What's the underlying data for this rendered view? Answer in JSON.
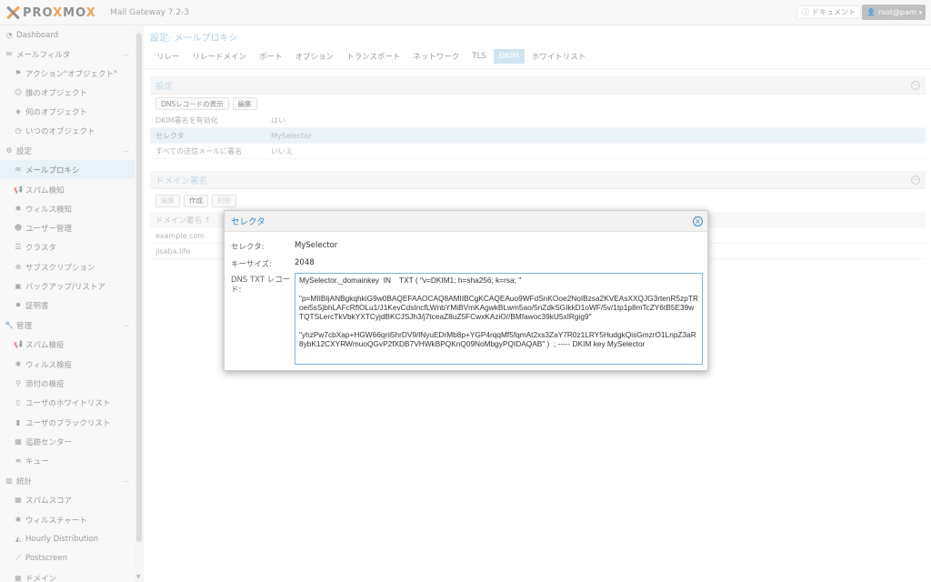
{
  "app": {
    "brand_pre": "PRO",
    "brand_x": "X",
    "brand_mo": "MO",
    "brand_x2": "X",
    "version": "Mail Gateway 7.2-3"
  },
  "topbar": {
    "docs_label": "ドキュメント",
    "user_label": "root@pam"
  },
  "sidebar": {
    "items": [
      {
        "label": "Dashboard",
        "icon": "dashboard-icon"
      },
      {
        "label": "メールフィルタ",
        "icon": "envelope-icon"
      },
      {
        "label": "アクション\"オブジェクト\"",
        "icon": "flag-icon"
      },
      {
        "label": "誰のオブジェクト",
        "icon": "user-icon"
      },
      {
        "label": "何のオブジェクト",
        "icon": "cube-icon"
      },
      {
        "label": "いつのオブジェクト",
        "icon": "clock-icon"
      },
      {
        "label": "設定",
        "icon": "gears-icon"
      },
      {
        "label": "メールプロキシ",
        "icon": "envelope-o-icon"
      },
      {
        "label": "スパム検知",
        "icon": "bullhorn-icon"
      },
      {
        "label": "ウィルス検知",
        "icon": "bug-icon"
      },
      {
        "label": "ユーザー管理",
        "icon": "users-icon"
      },
      {
        "label": "クラスタ",
        "icon": "server-icon"
      },
      {
        "label": "サブスクリプション",
        "icon": "support-icon"
      },
      {
        "label": "バックアップ/リストア",
        "icon": "floppy-icon"
      },
      {
        "label": "証明書",
        "icon": "certificate-icon"
      },
      {
        "label": "管理",
        "icon": "wrench-icon"
      },
      {
        "label": "スパム検疫",
        "icon": "bullhorn-icon"
      },
      {
        "label": "ウィルス検疫",
        "icon": "bug-icon"
      },
      {
        "label": "添付の検疫",
        "icon": "paperclip-icon"
      },
      {
        "label": "ユーザのホワイトリスト",
        "icon": "file-o-icon"
      },
      {
        "label": "ユーザのブラックリスト",
        "icon": "file-icon"
      },
      {
        "label": "追跡センター",
        "icon": "map-icon"
      },
      {
        "label": "キュー",
        "icon": "bars-icon"
      },
      {
        "label": "統計",
        "icon": "bar-chart-icon"
      },
      {
        "label": "スパムスコア",
        "icon": "table-icon"
      },
      {
        "label": "ウィルスチャート",
        "icon": "bug-icon"
      },
      {
        "label": "Hourly Distribution",
        "icon": "area-chart-icon"
      },
      {
        "label": "Postscreen",
        "icon": "line-chart-icon"
      },
      {
        "label": "ドメイン",
        "icon": "table-icon"
      }
    ]
  },
  "main": {
    "title": "設定: メールプロキシ",
    "tabs": [
      "リレー",
      "リレードメイン",
      "ポート",
      "オプション",
      "トランスポート",
      "ネットワーク",
      "TLS",
      "DKIM",
      "ホワイトリスト"
    ],
    "active_tab": "DKIM",
    "settings": {
      "header": "設定",
      "btn_dns": "DNSレコードの表示",
      "btn_edit": "編集",
      "rows": [
        {
          "key": "DKIM署名を有効化",
          "value": "はい"
        },
        {
          "key": "セレクタ",
          "value": "MySelector"
        },
        {
          "key": "すべての送信メールに署名",
          "value": "いいえ"
        }
      ]
    },
    "domains": {
      "header": "ドメイン署名",
      "btn_edit": "編集",
      "btn_create": "作成",
      "btn_delete": "削除",
      "col_header": "ドメイン署名 ↑",
      "rows": [
        "example.com",
        "jisaba.life"
      ]
    }
  },
  "dialog": {
    "title": "セレクタ",
    "selector_label": "セレクタ:",
    "selector_value": "MySelector",
    "keysize_label": "キーサイズ:",
    "keysize_value": "2048",
    "dns_label": "DNS TXT レコード:",
    "dns_value": "MySelector._domainkey  IN    TXT ( \"v=DKIM1; h=sha256; k=rsa; \"\n\n\"p=MIIBIjANBgkqhkiG9w0BAQEFAAOCAQ8AMIIBCgKCAQEAuo9WFdSnKOoe2NoIBzsa2KVEAsXXQJG3rtenR5zpTRoei5sSjbhLAFcRflOLu1/J1KevCdsIncfLWnbYMiBVmKAgwkBLwm5ao/5nZdkSGIkkD1oWF/5v/1tp1p8mTcZY6tB5E39wTQTSLercTkVbkYXTCyjdBKCJSJh3/j7tceaZ8uZ5FCwxKAziO//BMfawoc39kU5xIRgig9\"\n\n\"yhzPw7cbXap+HGW66qrii5hrDV9/lNyuEDrMb8p+YGP4rqqMf5fqmAt2xs3ZaY7R0z1LRY5HudgkQisGmzrO1LnpZ3aR8ybK12CXYRWmuoQGvP2fXDB7VHWkBPQKnQ09NoMbgyPQIDAQAB\" )  ; ----- DKIM key MySelector"
  }
}
